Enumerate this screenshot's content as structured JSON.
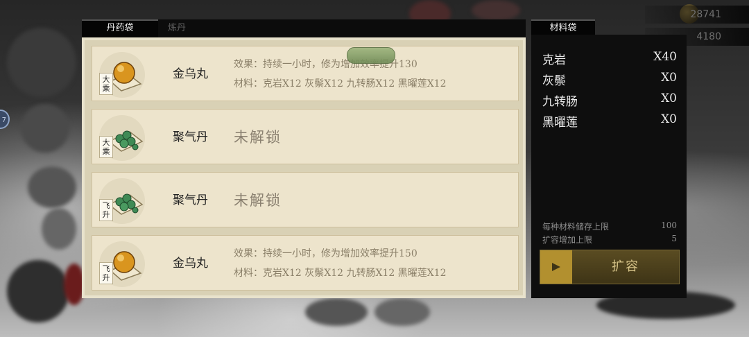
{
  "background": {
    "resource_1": "28741",
    "resource_2": "4180",
    "badge_text": "7"
  },
  "tabs": {
    "pill_bag": "丹药袋",
    "refine": "炼丹"
  },
  "pills": [
    {
      "name": "金乌丸",
      "tier": "大乘",
      "icon": "golden-orb-icon",
      "effect": "效果：持续一小时，修为增加效率提升130",
      "materials": "材料：克岩X12 灰鬃X12 九转肠X12 黑曜莲X12",
      "locked": false
    },
    {
      "name": "聚气丹",
      "tier": "大乘",
      "icon": "green-pills-icon",
      "locked_text": "未解锁",
      "locked": true
    },
    {
      "name": "聚气丹",
      "tier": "飞升",
      "icon": "green-pills-icon",
      "locked_text": "未解锁",
      "locked": true
    },
    {
      "name": "金乌丸",
      "tier": "飞升",
      "icon": "golden-orb-icon",
      "effect": "效果：持续一小时，修为增加效率提升150",
      "materials": "材料：克岩X12 灰鬃X12 九转肠X12 黑曜莲X12",
      "locked": false
    }
  ],
  "material_bag": {
    "title": "材料袋",
    "items": [
      {
        "name": "克岩",
        "qty": "X40"
      },
      {
        "name": "灰鬃",
        "qty": "X0"
      },
      {
        "name": "九转肠",
        "qty": "X0"
      },
      {
        "name": "黑曜莲",
        "qty": "X0"
      }
    ],
    "storage_limit_label": "每种材料储存上限",
    "storage_limit_value": "100",
    "expand_increase_label": "扩容增加上限",
    "expand_increase_value": "5",
    "expand_button": "扩容"
  },
  "colors": {
    "card_bg": "#ede4cc",
    "panel_bg": "#d9d1b5",
    "button_gold": "#b2902f"
  }
}
